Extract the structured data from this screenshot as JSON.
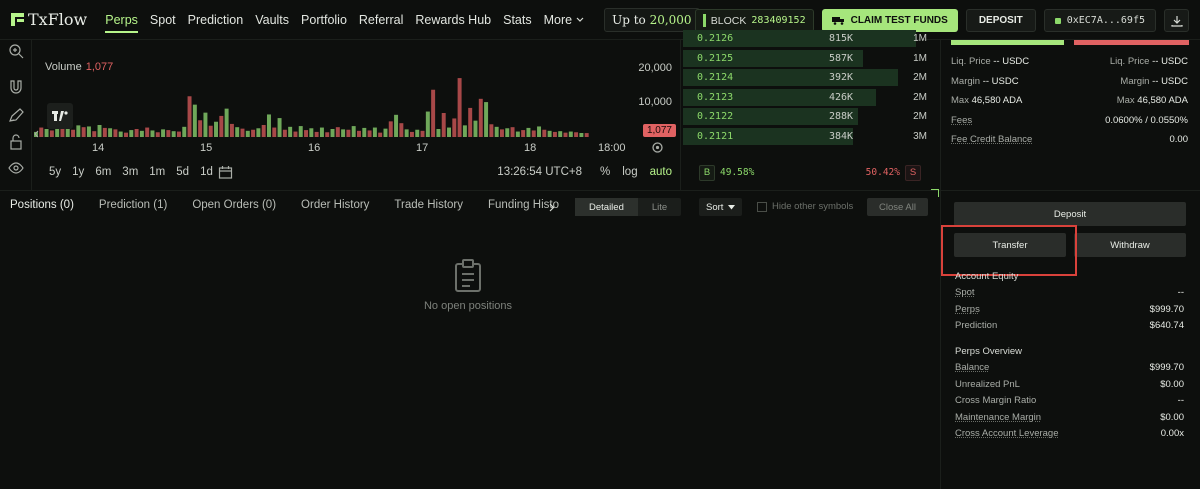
{
  "app": {
    "logo_text": "TxFlow"
  },
  "nav": {
    "items": [
      "Perps",
      "Spot",
      "Prediction",
      "Vaults",
      "Portfolio",
      "Referral",
      "Rewards Hub",
      "Stats"
    ],
    "more_label": "More",
    "active": "Perps",
    "promo_prefix": "Up to",
    "promo_value": "20,000"
  },
  "header": {
    "block_label": "BLOCK",
    "block_value": "283409152",
    "claim_label": "CLAIM TEST FUNDS",
    "deposit_label": "DEPOSIT",
    "wallet": "0xEC7A...69f5"
  },
  "chart": {
    "volume_label": "Volume",
    "volume_value": "1,077",
    "y_ticks": [
      "20,000",
      "10,000"
    ],
    "last_tag": "1,077",
    "x_ticks": [
      "14",
      "15",
      "16",
      "17",
      "18",
      "18:00"
    ],
    "ranges": [
      "5y",
      "1y",
      "6m",
      "3m",
      "1m",
      "5d",
      "1d"
    ],
    "time": "13:26:54 UTC+8",
    "scale_opts": [
      "%",
      "log",
      "auto"
    ]
  },
  "chart_data": {
    "type": "bar",
    "title": "",
    "ylabel": "Volume",
    "ylim": [
      0,
      22000
    ],
    "x_ticks": [
      "14",
      "15",
      "16",
      "17",
      "18",
      "18:00"
    ],
    "series": [
      {
        "name": "Volume",
        "values": [
          1400,
          2600,
          2200,
          1800,
          3500,
          2300,
          2800,
          2000,
          3200,
          2700,
          2900,
          1600,
          3300,
          2500,
          2400,
          2100,
          1500,
          1200,
          1900,
          2200,
          1700,
          2600,
          1800,
          1300,
          2100,
          1900,
          1600,
          1500,
          2800,
          11200,
          8900,
          4600,
          6700,
          3100,
          4200,
          5800,
          7800,
          3600,
          2700,
          2300,
          1700,
          2000,
          2400,
          3300,
          6200,
          2600,
          5200,
          2000,
          2800,
          1500,
          3000,
          1900,
          2400,
          1400,
          2600,
          1300,
          2200,
          2700,
          2100,
          2000,
          3000,
          1700,
          2500,
          1800,
          2600,
          1200,
          2300,
          4300,
          6100,
          3800,
          2100,
          1400,
          2000,
          1700,
          7000,
          13000,
          2200,
          6600,
          2600,
          5100,
          16200,
          3200,
          8000,
          4500,
          10500,
          9600,
          3500,
          2800,
          2100,
          2400,
          2700,
          1500,
          1900,
          2500,
          1800,
          2900,
          2000,
          1700,
          1400,
          1600,
          1200,
          1500,
          1300,
          1100,
          1077
        ],
        "colors": [
          "g",
          "r",
          "g",
          "r",
          "g",
          "r",
          "g",
          "r",
          "g",
          "r",
          "g",
          "r",
          "g",
          "r",
          "g",
          "r",
          "g",
          "r",
          "g",
          "r",
          "g",
          "r",
          "g",
          "r",
          "g",
          "r",
          "g",
          "r",
          "g",
          "r",
          "g",
          "r",
          "g",
          "r",
          "g",
          "r",
          "g",
          "r",
          "g",
          "r",
          "g",
          "r",
          "g",
          "r",
          "g",
          "r",
          "g",
          "r",
          "g",
          "r",
          "g",
          "r",
          "g",
          "r",
          "g",
          "r",
          "g",
          "r",
          "g",
          "r",
          "g",
          "r",
          "g",
          "r",
          "g",
          "r",
          "g",
          "r",
          "g",
          "r",
          "g",
          "r",
          "g",
          "r",
          "g",
          "r",
          "g",
          "r",
          "g",
          "r",
          "r",
          "g",
          "r",
          "g",
          "r",
          "g",
          "r",
          "g",
          "r",
          "g",
          "r",
          "g",
          "r",
          "g",
          "r",
          "g",
          "r",
          "g",
          "r",
          "g",
          "r",
          "g",
          "r",
          "g",
          "r"
        ]
      }
    ]
  },
  "orderbook": {
    "rows": [
      {
        "price": "0.2126",
        "size": "815K",
        "total": "1M",
        "fill": 0.93
      },
      {
        "price": "0.2125",
        "size": "587K",
        "total": "1M",
        "fill": 0.72
      },
      {
        "price": "0.2124",
        "size": "392K",
        "total": "2M",
        "fill": 0.86
      },
      {
        "price": "0.2123",
        "size": "426K",
        "total": "2M",
        "fill": 0.77
      },
      {
        "price": "0.2122",
        "size": "288K",
        "total": "2M",
        "fill": 0.7
      },
      {
        "price": "0.2121",
        "size": "384K",
        "total": "3M",
        "fill": 0.68
      }
    ],
    "buy_label": "B",
    "sell_label": "S",
    "buy_pct": "49.58%",
    "sell_pct": "50.42%"
  },
  "order_info": {
    "liq_label": "Liq. Price",
    "liq_value": "-- USDC",
    "margin_label": "Margin",
    "margin_value": "-- USDC",
    "max_label": "Max",
    "max_value": "46,580 ADA",
    "fees_label": "Fees",
    "fees_value": "0.0600% / 0.0550%",
    "fee_credit_label": "Fee Credit Balance",
    "fee_credit_value": "0.00"
  },
  "positions": {
    "tabs": [
      "Positions (0)",
      "Prediction (1)",
      "Open Orders (0)",
      "Order History",
      "Trade History",
      "Funding Histo"
    ],
    "view_detailed": "Detailed",
    "view_lite": "Lite",
    "sort_label": "Sort",
    "hide_label": "Hide other symbols",
    "close_all": "Close All",
    "empty_text": "No open positions"
  },
  "account": {
    "deposit": "Deposit",
    "transfer": "Transfer",
    "withdraw": "Withdraw",
    "equity_title": "Account Equity",
    "equity_rows": [
      {
        "label": "Spot",
        "value": "--"
      },
      {
        "label": "Perps",
        "value": "$999.70"
      },
      {
        "label": "Prediction",
        "value": "$640.74"
      }
    ],
    "perps_title": "Perps Overview",
    "perps_rows": [
      {
        "label": "Balance",
        "value": "$999.70"
      },
      {
        "label": "Unrealized PnL",
        "value": "$0.00"
      },
      {
        "label": "Cross Margin Ratio",
        "value": "--"
      },
      {
        "label": "Maintenance Margin",
        "value": "$0.00"
      },
      {
        "label": "Cross Account Leverage",
        "value": "0.00x"
      }
    ]
  },
  "colors": {
    "accent": "#b6f48a",
    "buy": "#8cd96a",
    "sell": "#e06262",
    "highlight": "#d9423b",
    "vol_up": "#6fa85a",
    "vol_down": "#a74848"
  }
}
